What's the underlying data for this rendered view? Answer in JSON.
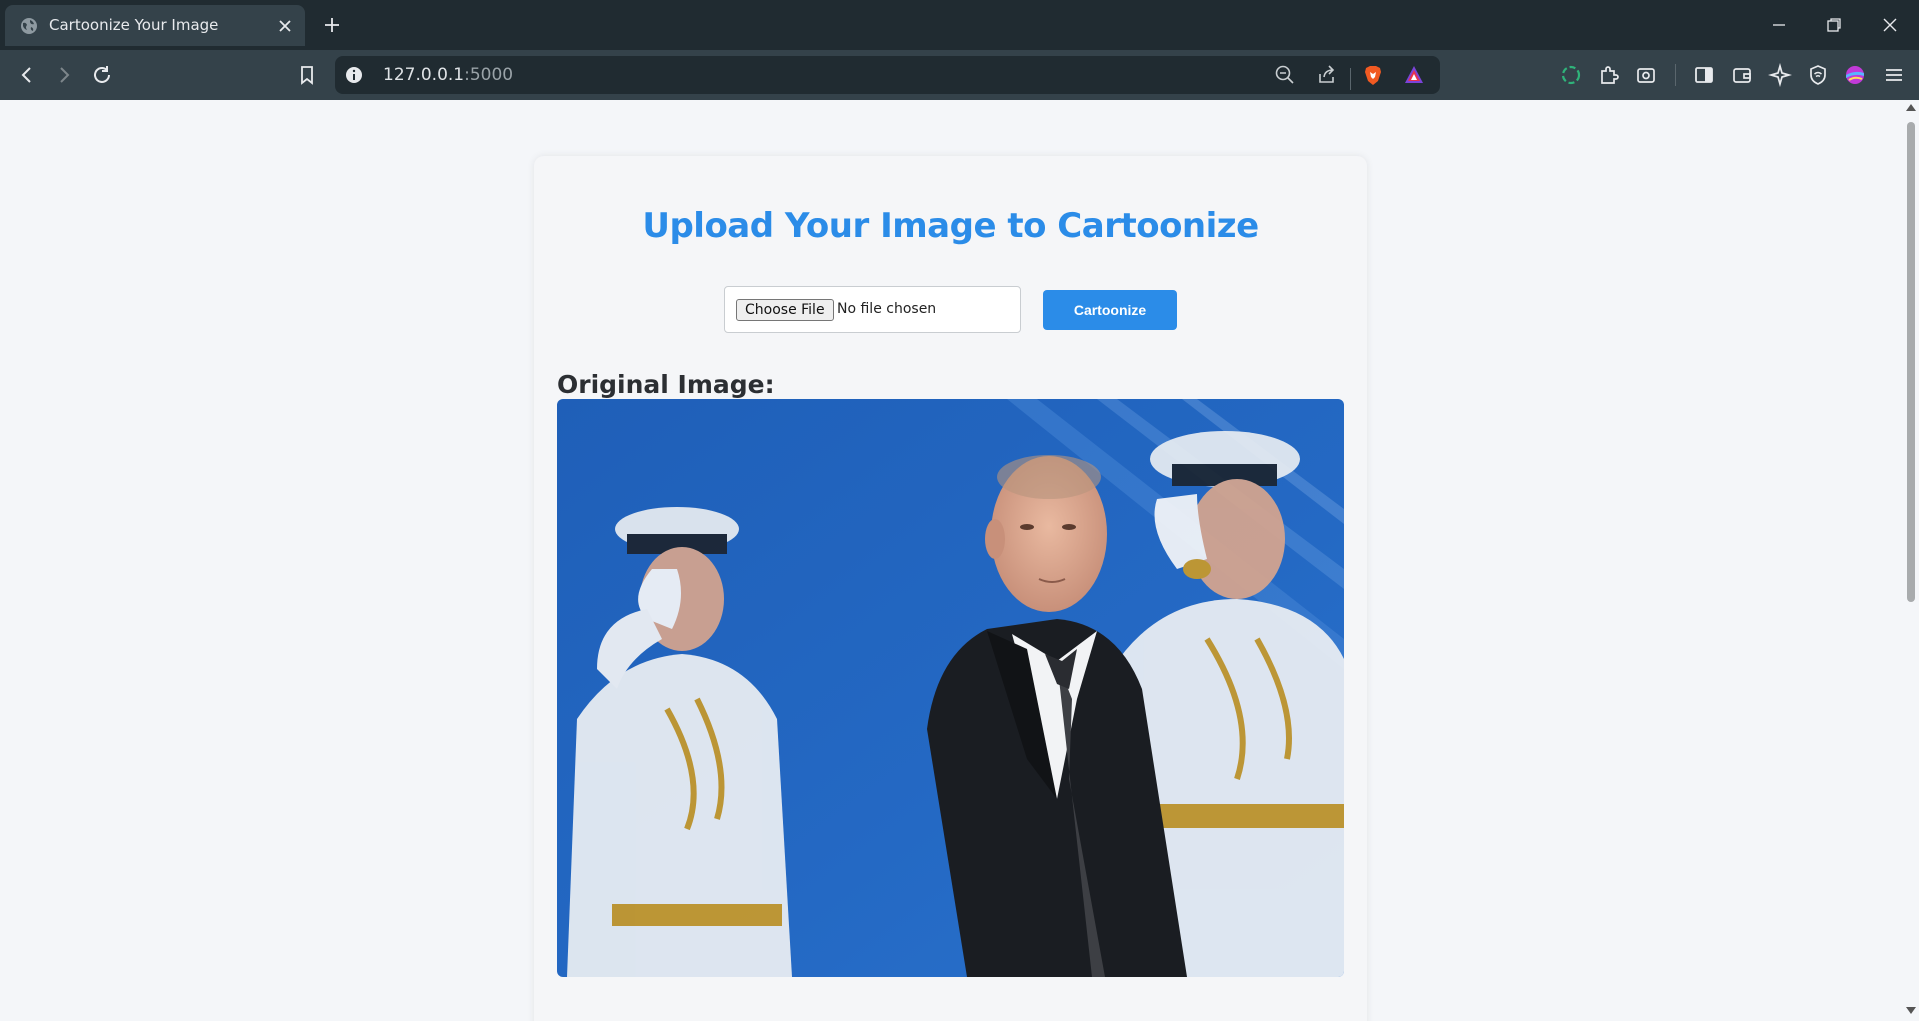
{
  "browser": {
    "tab_title": "Cartoonize Your Image",
    "url_host": "127.0.0.1",
    "url_port": ":5000",
    "icons": [
      "globe-icon",
      "close-icon",
      "plus-icon",
      "minimize-icon",
      "restore-icon",
      "back-icon",
      "forward-icon",
      "reload-icon",
      "bookmark-icon",
      "info-icon",
      "zoom-out-icon",
      "share-icon",
      "brave-shield-icon",
      "rewards-icon",
      "extension-icon",
      "puzzle-icon",
      "screenshot-icon",
      "sidebar-icon",
      "wallet-icon",
      "ai-icon",
      "vpn-icon",
      "profile-icon",
      "menu-icon"
    ]
  },
  "page": {
    "heading": "Upload Your Image to Cartoonize",
    "choose_file_label": "Choose File",
    "no_file_text": "No file chosen",
    "submit_label": "Cartoonize",
    "original_label": "Original Image:",
    "accent_color": "#2b8ce8"
  }
}
